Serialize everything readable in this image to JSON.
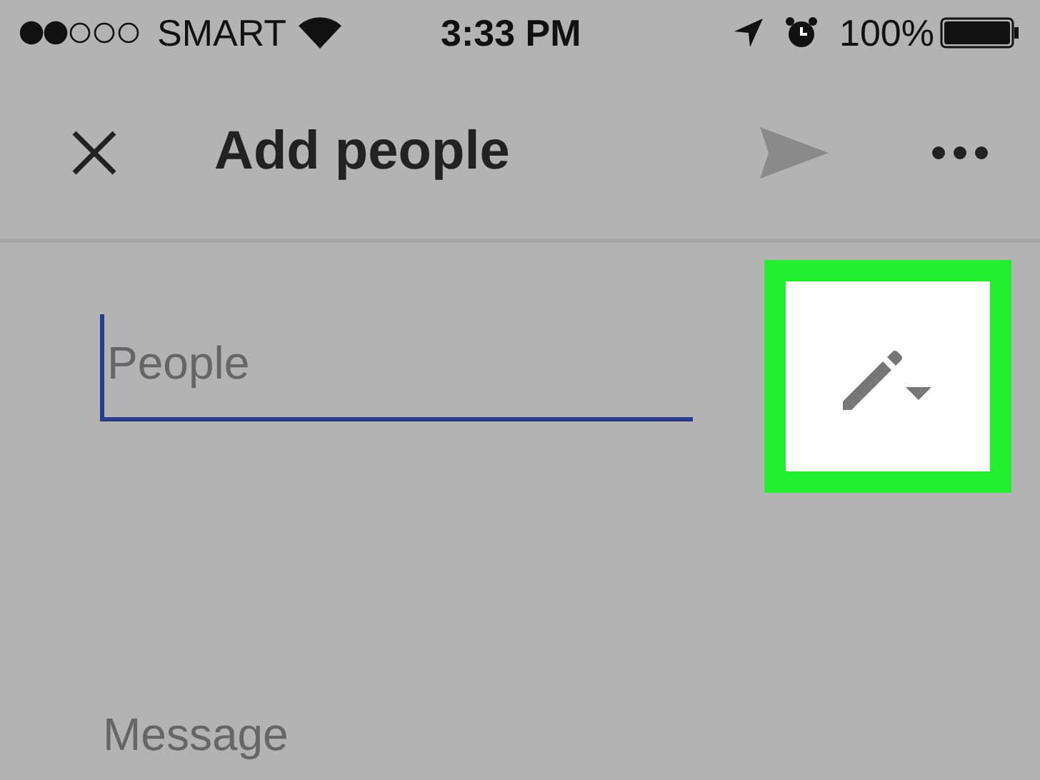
{
  "status_bar": {
    "carrier": "SMART",
    "time": "3:33 PM",
    "battery": "100%"
  },
  "header": {
    "title": "Add people",
    "send_disabled": true
  },
  "people_field": {
    "placeholder": "People",
    "focused": true
  },
  "edit_button": {
    "highlighted": true
  },
  "message_field": {
    "placeholder": "Message"
  }
}
